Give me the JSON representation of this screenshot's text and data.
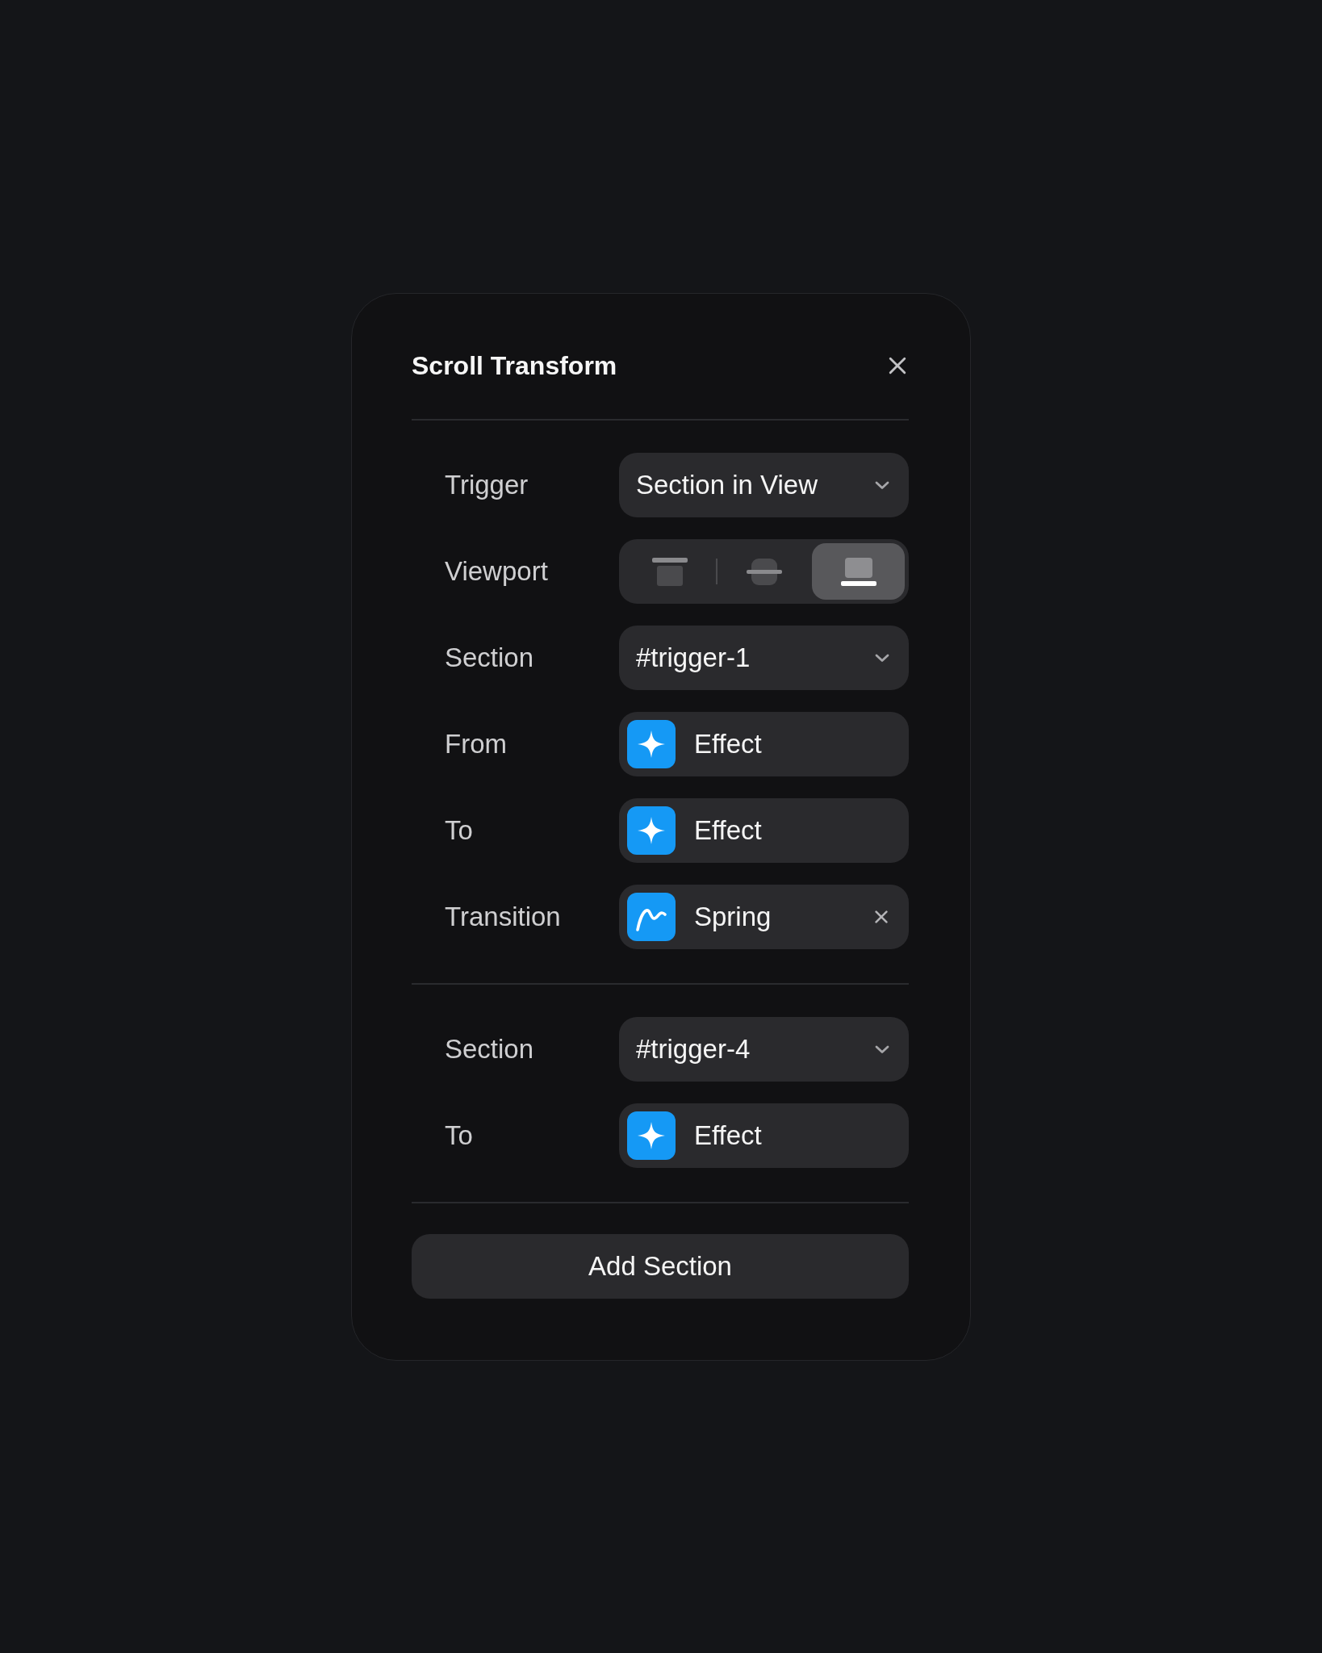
{
  "panel": {
    "title": "Scroll Transform"
  },
  "groups": [
    {
      "rows": [
        {
          "kind": "select",
          "label": "Trigger",
          "value": "Section in View"
        },
        {
          "kind": "segmented",
          "label": "Viewport",
          "options": [
            {
              "selected": false
            },
            {
              "selected": false
            },
            {
              "selected": true
            }
          ]
        },
        {
          "kind": "select",
          "label": "Section",
          "value": "#trigger-1"
        },
        {
          "kind": "effect",
          "label": "From",
          "value": "Effect"
        },
        {
          "kind": "effect",
          "label": "To",
          "value": "Effect"
        },
        {
          "kind": "transition",
          "label": "Transition",
          "value": "Spring"
        }
      ]
    },
    {
      "rows": [
        {
          "kind": "select",
          "label": "Section",
          "value": "#trigger-4"
        },
        {
          "kind": "effect",
          "label": "To",
          "value": "Effect"
        }
      ]
    }
  ],
  "add_button": {
    "label": "Add Section"
  }
}
